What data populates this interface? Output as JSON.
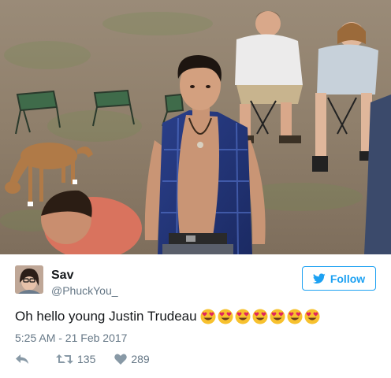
{
  "tweet": {
    "photo_alt": "Young man in an open plaid shirt standing in a field with people on folding chairs and a dog",
    "author": {
      "display_name": "Sav",
      "handle": "@PhuckYou_"
    },
    "follow_label": "Follow",
    "text": "Oh hello young Justin Trudeau",
    "emoji_icons": [
      "heart-eyes-emoji",
      "heart-eyes-emoji",
      "heart-eyes-emoji",
      "heart-eyes-emoji",
      "heart-eyes-emoji",
      "heart-eyes-emoji",
      "heart-eyes-emoji"
    ],
    "timestamp": "5:25 AM - 21 Feb 2017",
    "actions": {
      "reply_icon": "reply-icon",
      "retweet_icon": "retweet-icon",
      "retweet_count": "135",
      "like_icon": "heart-icon",
      "like_count": "289"
    }
  },
  "colors": {
    "accent": "#1da1f2",
    "secondary_text": "#657786",
    "primary_text": "#14171a",
    "action_icon": "#8899a6"
  }
}
